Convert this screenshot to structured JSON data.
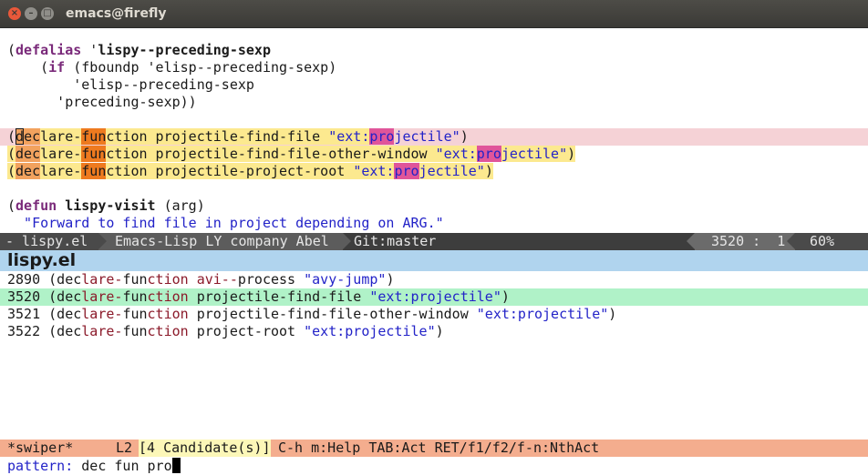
{
  "window": {
    "title": "emacs@firefly",
    "close_glyph": "×",
    "min_glyph": "–",
    "max_glyph": "□"
  },
  "code": {
    "defalias": [
      "(",
      "defalias",
      " '",
      "lispy--preceding-sexp"
    ],
    "if_line": [
      "    (",
      "if",
      " (fboundp 'elisp--preceding-sexp)"
    ],
    "elisp_line": "        'elisp--preceding-sexp",
    "preceding_line": "      'preceding-sexp))",
    "decl1": [
      "(",
      "d",
      "ec",
      "lare-",
      "fun",
      "ction projectile-find-file ",
      "\"ext:",
      "pro",
      "jectile\"",
      ")"
    ],
    "decl2": [
      "(",
      "dec",
      "lare-",
      "fun",
      "ction projectile-find-file-other-window ",
      "\"ext:",
      "pro",
      "jectile\"",
      ")"
    ],
    "decl3": [
      "(",
      "dec",
      "lare-",
      "fun",
      "ction projectile-project-root ",
      "\"ext:",
      "pro",
      "jectile\"",
      ")"
    ],
    "defun_line": [
      "(",
      "defun",
      " ",
      "lispy-visit",
      " (arg)"
    ],
    "docstring": "  \"Forward to find file in project depending on ARG.\""
  },
  "modeline": {
    "buffer": "- lispy.el",
    "modes": "Emacs-Lisp LY company Abel",
    "vc": "Git:master",
    "position": "3520 :  1",
    "percent": "60%"
  },
  "swiper": {
    "buffer_title": "lispy.el",
    "results": [
      {
        "line": "2890",
        "pre": " (dec",
        "a": "lare-",
        "b": "fun",
        "c": "ction avi--",
        "d": "pro",
        "e": "cess ",
        "str": "\"avy-jump\"",
        "end": ")"
      },
      {
        "line": "3520",
        "pre": " (dec",
        "a": "lare-",
        "b": "fun",
        "c": "ction ",
        "d": "pro",
        "e": "jectile-find-file ",
        "str": "\"ext:projectile\"",
        "end": ")"
      },
      {
        "line": "3521",
        "pre": " (dec",
        "a": "lare-",
        "b": "fun",
        "c": "ction ",
        "d": "pro",
        "e": "jectile-find-file-other-window ",
        "str": "\"ext:projectile\"",
        "end": ")"
      },
      {
        "line": "3522",
        "pre": " (dec",
        "a": "lare-",
        "b": "fun",
        "c": "ction ",
        "d": "pro",
        "e": "ject-root ",
        "str": "\"ext:projectile\"",
        "end": ")"
      }
    ],
    "bar_name": "*swiper*",
    "bar_line": "L2",
    "bar_candidates": "[4 Candidate(s)]",
    "bar_help": "C-h m:Help TAB:Act RET/f1/f2/f-n:NthAct",
    "prompt": "pattern: ",
    "input": "dec fun pro"
  },
  "colors": {
    "keyword": "#7a2a7a",
    "string": "#2323c8",
    "current_line": "#f5d2d6",
    "match_line": "#fce98f",
    "selected_result": "#b0f2c8",
    "header": "#b0d4ee",
    "swiper_bar": "#f4ad8e"
  }
}
